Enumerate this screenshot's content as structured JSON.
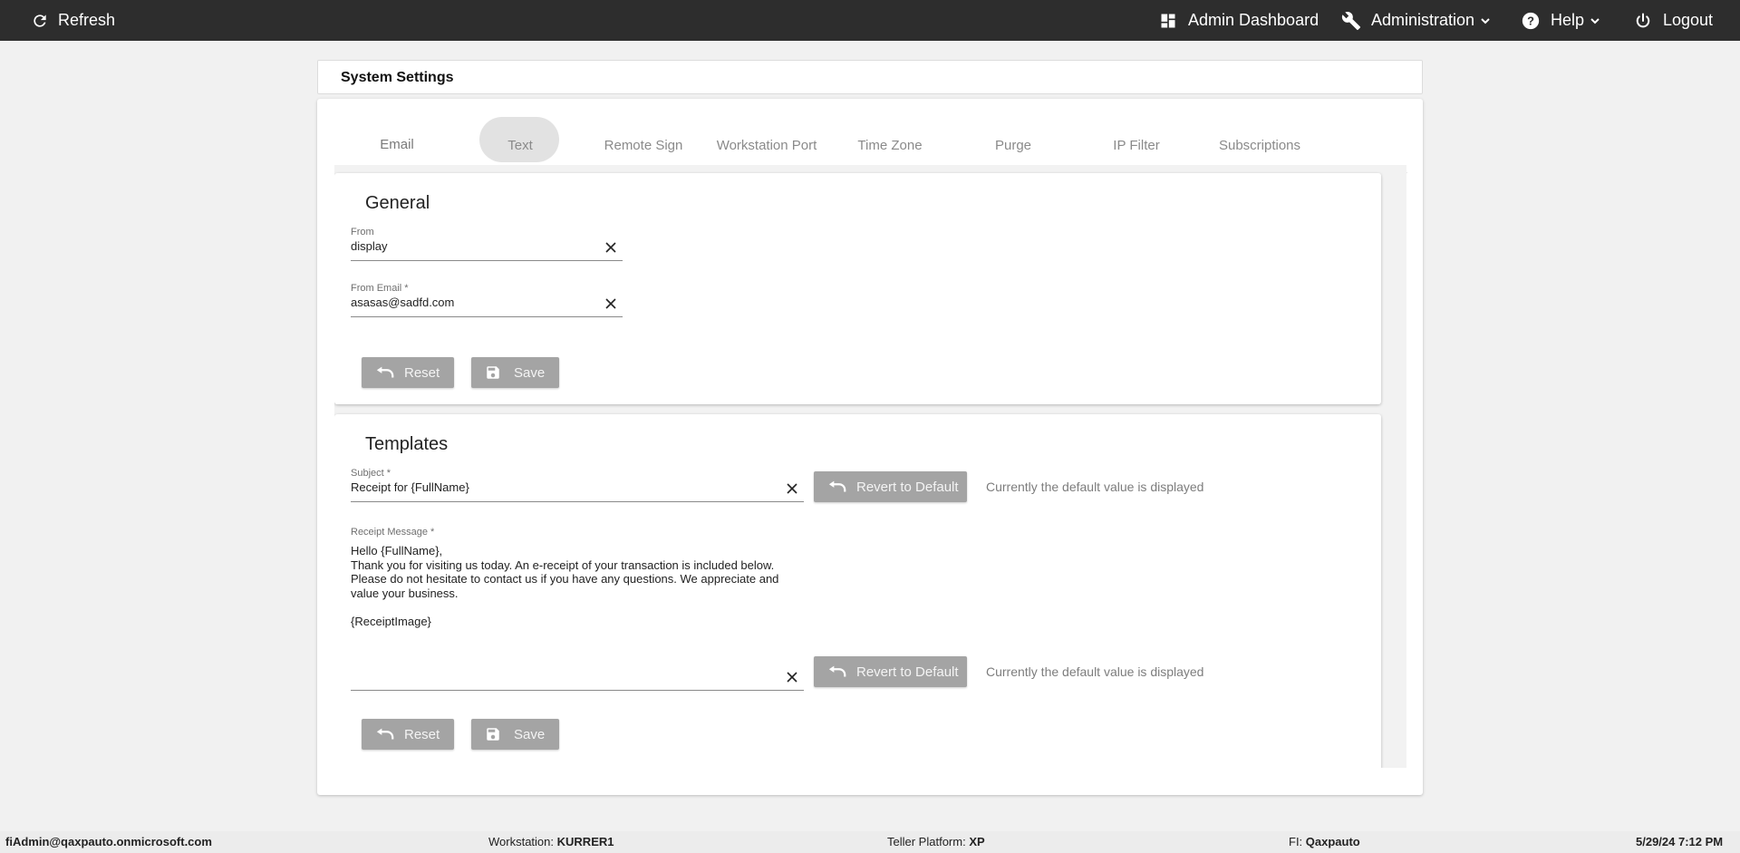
{
  "topbar": {
    "refresh_label": "Refresh",
    "admin_dashboard_label": "Admin Dashboard",
    "administration_label": "Administration",
    "help_label": "Help",
    "logout_label": "Logout"
  },
  "page": {
    "title": "System Settings"
  },
  "tabs": [
    {
      "label": "Email",
      "active": true
    },
    {
      "label": "Text"
    },
    {
      "label": "Remote Sign"
    },
    {
      "label": "Workstation Port"
    },
    {
      "label": "Time Zone"
    },
    {
      "label": "Purge"
    },
    {
      "label": "IP Filter"
    },
    {
      "label": "Subscriptions"
    }
  ],
  "general": {
    "title": "General",
    "from": {
      "label": "From",
      "value": "display"
    },
    "from_email": {
      "label": "From Email *",
      "value": "asasas@sadfd.com"
    },
    "reset_label": "Reset",
    "save_label": "Save"
  },
  "templates": {
    "title": "Templates",
    "subject": {
      "label": "Subject *",
      "value": "Receipt for {FullName}"
    },
    "receipt_message": {
      "label": "Receipt Message *",
      "value": "Hello {FullName},\nThank you for visiting us today. An e-receipt of your transaction is included below. Please do not hesitate to contact us if you have any questions. We appreciate and value your business.\n\n{ReceiptImage}"
    },
    "revert_label": "Revert to Default",
    "default_note": "Currently the default value is displayed",
    "reset_label": "Reset",
    "save_label": "Save"
  },
  "status": {
    "user": "fiAdmin@qaxpauto.onmicrosoft.com",
    "workstation_label": "Workstation:",
    "workstation_value": "KURRER1",
    "teller_label": "Teller Platform:",
    "teller_value": "XP",
    "fi_label": "FI:",
    "fi_value": "Qaxpauto",
    "datetime": "5/29/24 7:12 PM"
  },
  "colors": {
    "topbar_bg": "#2d2d2d",
    "tab_indicator": "#3f51b5",
    "button_bg": "#a4a4a4"
  }
}
